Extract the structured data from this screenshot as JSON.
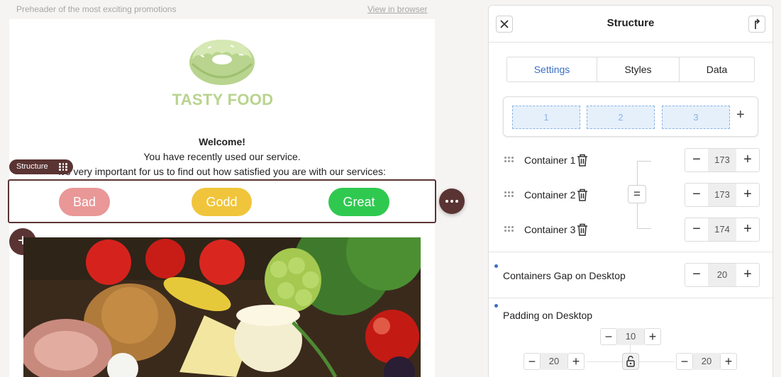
{
  "email": {
    "preheader": "Preheader of the most exciting promotions",
    "view_in_browser": "View in browser",
    "logo_text": "TASTY FOOD",
    "welcome": "Welcome!",
    "line1": "You have recently used our service.",
    "line2": "It's very important for us to find out how satisfied you are with our services:",
    "structure_tag": "Structure",
    "buttons": [
      "Bad",
      "Godd",
      "Great"
    ],
    "add_symbol": "+"
  },
  "colors": {
    "accent_dark": "#5a3433",
    "bad": "#e99797",
    "godd": "#f0c53b",
    "great": "#2fc950",
    "logo": "#b8d48e",
    "tab_active": "#3b6fc4"
  },
  "panel": {
    "title": "Structure",
    "tabs": [
      {
        "label": "Settings",
        "active": true
      },
      {
        "label": "Styles",
        "active": false
      },
      {
        "label": "Data",
        "active": false
      }
    ],
    "columns": [
      "1",
      "2",
      "3"
    ],
    "add_column_symbol": "+",
    "containers": [
      {
        "label": "Container 1",
        "width": "173"
      },
      {
        "label": "Container 2",
        "width": "173"
      },
      {
        "label": "Container 3",
        "width": "174"
      }
    ],
    "equal_symbol": "=",
    "gap_label": "Containers Gap on Desktop",
    "gap_value": "20",
    "padding_label": "Padding on Desktop",
    "padding": {
      "top": "10",
      "left": "20",
      "right": "20"
    },
    "minus": "−",
    "plus": "+"
  }
}
